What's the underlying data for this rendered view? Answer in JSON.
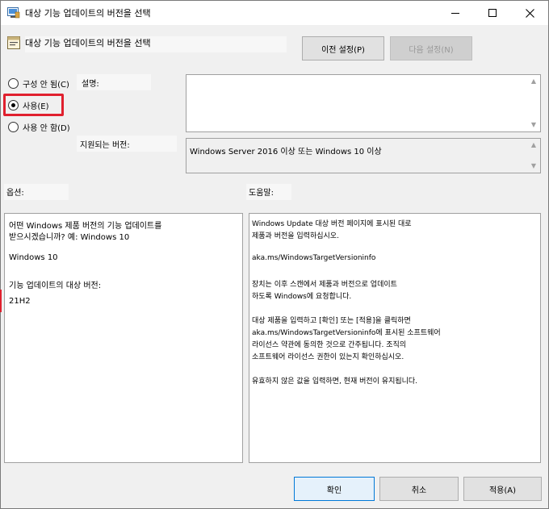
{
  "window": {
    "title": "대상 기능 업데이트의 버전을 선택"
  },
  "header": {
    "title": "대상 기능 업데이트의 버전을 선택"
  },
  "nav": {
    "prev_label": "이전 설정(P)",
    "next_label": "다음 설정(N)"
  },
  "state_options": [
    {
      "label": "구성 안 됨(C)",
      "checked": false
    },
    {
      "label": "사용(E)",
      "checked": true
    },
    {
      "label": "사용 안 함(D)",
      "checked": false
    }
  ],
  "labels": {
    "description": "설명:",
    "supported": "지원되는 버전:",
    "options": "옵션:",
    "help": "도움말:"
  },
  "supported_text": "Windows Server 2016 이상 또는 Windows 10 이상",
  "options_panel": {
    "product_question_line1": "어떤 Windows 제품 버전의 기능 업데이트를",
    "product_question_line2": "받으시겠습니까? 예: Windows 10",
    "product_value": "Windows 10",
    "version_label": "기능 업데이트의 대상 버전:",
    "version_value": "21H2"
  },
  "help_lines": [
    "Windows Update 대상 버전 페이지에 표시된 대로",
    "제품과 버전을 입력하십시오.",
    "",
    "aka.ms/WindowsTargetVersioninfo",
    "",
    "장치는 이후 스캔에서 제품과 버전으로 업데이트",
    "하도록 Windows에 요청합니다.",
    "",
    "대상 제품을 입력하고 [확인] 또는 [적용]을 클릭하면",
    "aka.ms/WindowsTargetVersioninfo에 표시된 소프트웨어",
    "라이선스 약관에 동의한 것으로 간주됩니다. 조직의",
    "소프트웨어 라이선스 권한이 있는지 확인하십시오.",
    "",
    "유효하지 않은 값을 입력하면, 현재 버전이 유지됩니다."
  ],
  "footer": {
    "ok_label": "확인",
    "cancel_label": "취소",
    "apply_label": "적용(A)"
  },
  "icons": {
    "window": "policy-icon",
    "minimize": "minimize-icon",
    "maximize": "maximize-icon",
    "close": "close-icon"
  },
  "colors": {
    "highlight": "#e0202e",
    "accent": "#0078d7"
  }
}
